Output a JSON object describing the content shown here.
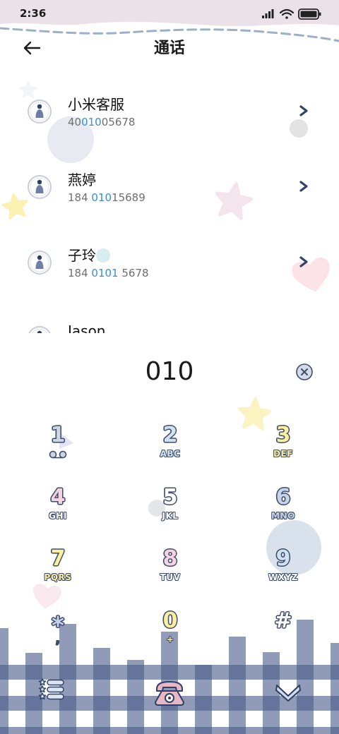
{
  "status_bar": {
    "time": "2:36",
    "icons": [
      "signal-icon",
      "wifi-icon",
      "battery-icon"
    ]
  },
  "header": {
    "title": "通话",
    "back_icon": "back-arrow-icon"
  },
  "contacts": [
    {
      "name": "小米客服",
      "number": {
        "before": "40",
        "match": "010",
        "after": "05678"
      }
    },
    {
      "name": "燕婷",
      "number": {
        "before": "184 ",
        "match": "010",
        "after": "15689"
      }
    },
    {
      "name": "子玲",
      "number": {
        "before": "184 ",
        "match": "0101",
        "after": " 5678"
      }
    },
    {
      "name": "Jason"
    }
  ],
  "dialer": {
    "input": "010",
    "delete_icon": "delete-icon"
  },
  "keypad": [
    {
      "digit": "1",
      "sub_icon": "voicemail-icon",
      "digit_color": "#cdd5e4"
    },
    {
      "digit": "2",
      "letters": "ABC",
      "digit_color": "#cfe2f0",
      "letters_color": "#cfe2f0"
    },
    {
      "digit": "3",
      "letters": "DEF",
      "digit_color": "#fbef9c",
      "letters_color": "#fbef9c"
    },
    {
      "digit": "4",
      "letters": "GHI",
      "digit_color": "#f6d3de",
      "letters_color": "#ffffff"
    },
    {
      "digit": "5",
      "letters": "JKL",
      "digit_color": "#ffffff",
      "letters_color": "#ffffff"
    },
    {
      "digit": "6",
      "letters": "MNO",
      "digit_color": "#c6d3e8",
      "letters_color": "#c6d3e8"
    },
    {
      "digit": "7",
      "letters": "PQRS",
      "digit_color": "#fbef9c",
      "letters_color": "#fbef9c"
    },
    {
      "digit": "8",
      "letters": "TUV",
      "digit_color": "#f6d3de",
      "letters_color": "#ffffff"
    },
    {
      "digit": "9",
      "letters": "WXYZ",
      "digit_color": "#cfe2f0",
      "letters_color": "#ffffff"
    },
    {
      "digit": "*",
      "letters": ",",
      "digit_color": "#c6d3e8",
      "letters_color": "#3d4b6b"
    },
    {
      "digit": "0",
      "letters": "+",
      "digit_color": "#fbef9c",
      "letters_color": "#fbef9c"
    },
    {
      "digit": "#",
      "digit_color": "#ffffff"
    }
  ],
  "bottom_bar": {
    "icons": [
      "menu-icon",
      "call-icon",
      "collapse-chevron-icon"
    ]
  },
  "colors": {
    "highlight": "#3a8dd8",
    "outline": "#3d4b6b",
    "gingham": "#5a6e96",
    "call_button": "#e8b7c6",
    "status_bg": "#ebe1e9"
  }
}
